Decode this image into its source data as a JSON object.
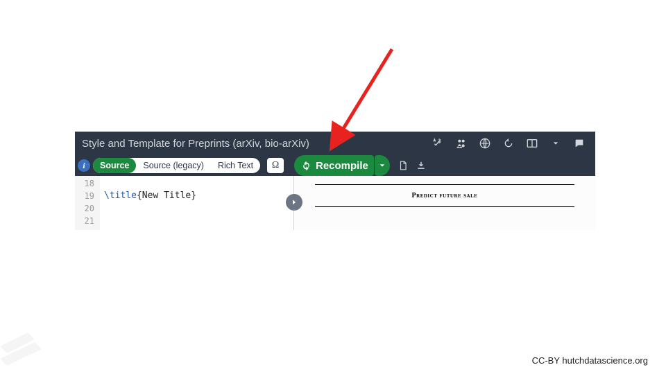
{
  "project_title": "Style and Template for Preprints (arXiv, bio-arXiv)",
  "info_badge": "i",
  "tabs": {
    "source": "Source",
    "source_legacy": "Source (legacy)",
    "rich_text": "Rich Text"
  },
  "omega_label": "Ω",
  "recompile": {
    "label": "Recompile"
  },
  "editor": {
    "line_numbers": [
      "18",
      "19",
      "20",
      "21"
    ],
    "line19_cmd": "\\title",
    "line19_arg": "{New Title}"
  },
  "pdf": {
    "title": "Predict future sale"
  },
  "attribution": "CC-BY hutchdatascience.org"
}
